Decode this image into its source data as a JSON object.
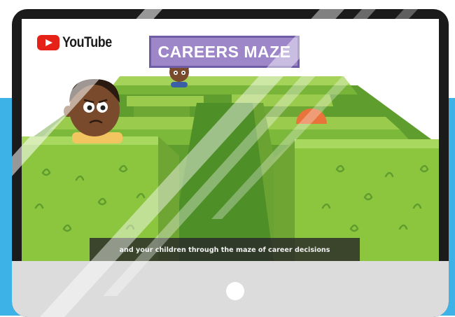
{
  "video_player": {
    "platform": "YouTube",
    "sign_text": "CAREERS MAZE",
    "caption": "and your children through the maze of career decisions"
  },
  "colors": {
    "youtube_red": "#e62117",
    "sign_purple": "#9d87c8",
    "hedge_green": "#8cc63f",
    "background_blue": "#3cb2e6",
    "monitor_frame": "#1b1b1b",
    "monitor_bezel": "#dcdcdc"
  },
  "icons": [
    "youtube-logo-icon",
    "play-icon",
    "power-button-icon"
  ]
}
